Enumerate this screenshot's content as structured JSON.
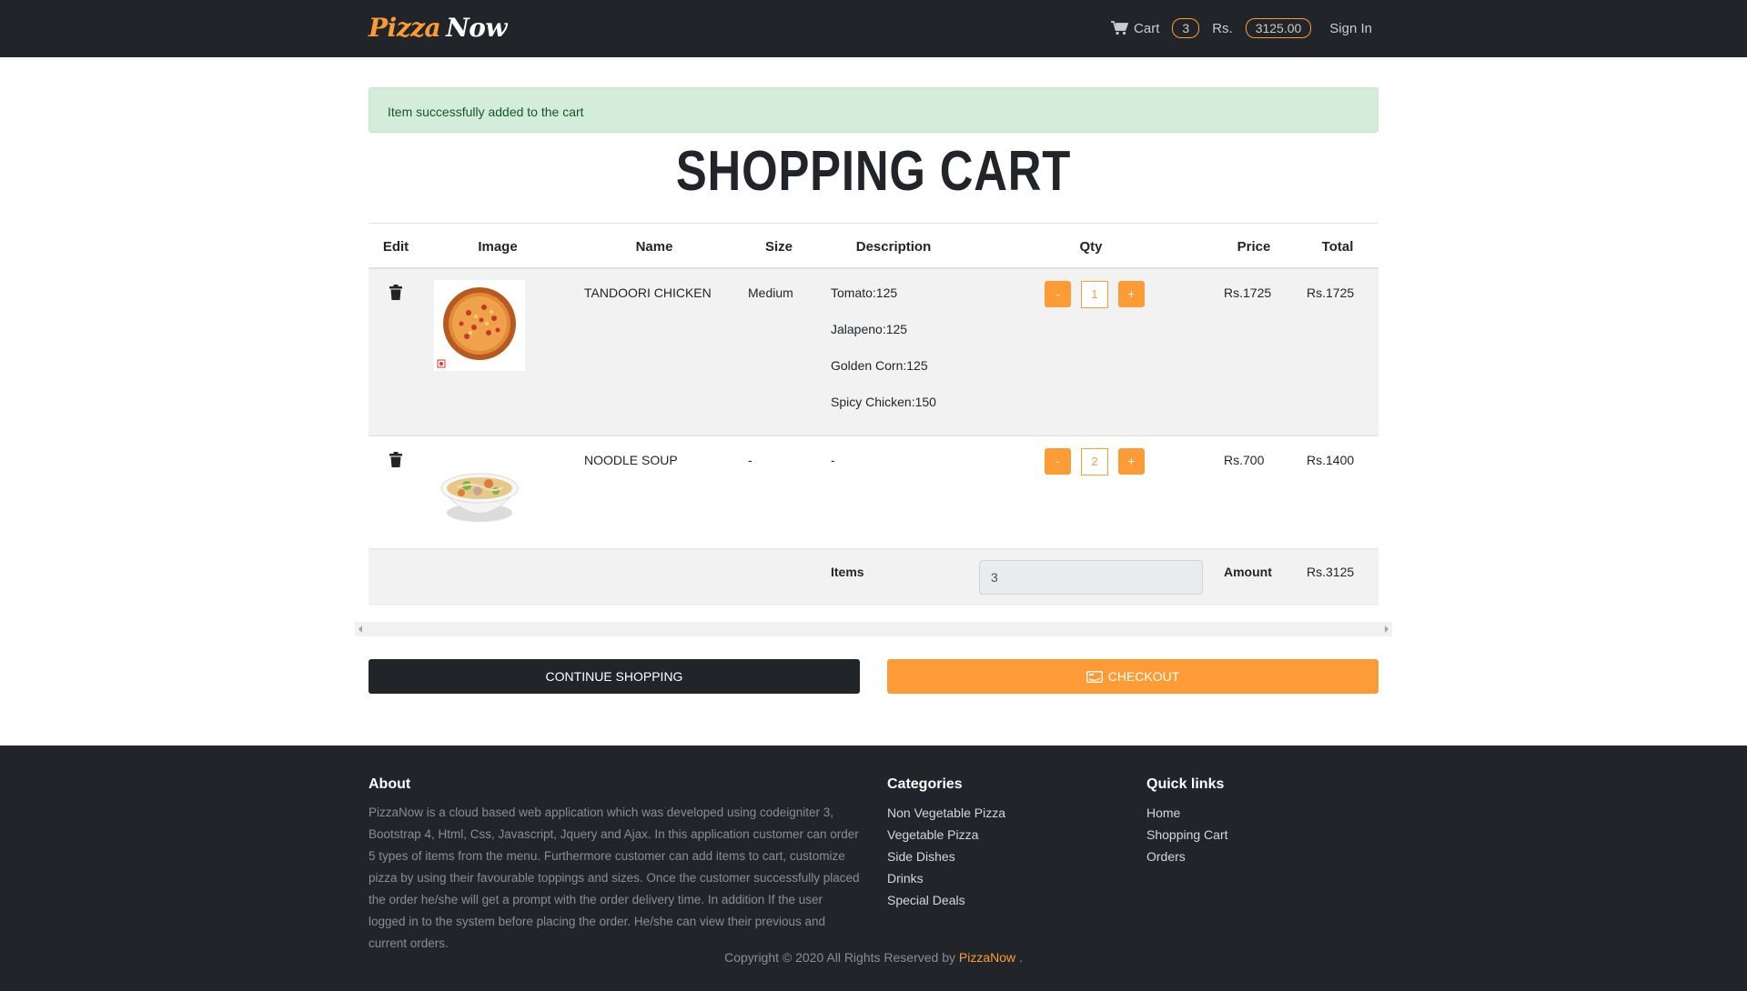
{
  "navbar": {
    "brand_part1": "Pizza",
    "brand_part2": "Now",
    "cart_label": "Cart",
    "cart_count": "3",
    "currency_label": "Rs.",
    "cart_total": "3125.00",
    "signin_label": "Sign In"
  },
  "alert": {
    "message": "Item successfully added to the cart"
  },
  "page_title": "SHOPPING CART",
  "table": {
    "headers": [
      "Edit",
      "Image",
      "Name",
      "Size",
      "Description",
      "Qty",
      "Price",
      "Total"
    ],
    "rows": [
      {
        "name": "TANDOORI CHICKEN",
        "size": "Medium",
        "description": [
          "Tomato:125",
          "Jalapeno:125",
          "Golden Corn:125",
          "Spicy Chicken:150"
        ],
        "qty_minus": "-",
        "qty": "1",
        "qty_plus": "+",
        "price": "Rs.1725",
        "total": "Rs.1725"
      },
      {
        "name": "NOODLE SOUP",
        "size": "-",
        "description": [
          "-"
        ],
        "qty_minus": "-",
        "qty": "2",
        "qty_plus": "+",
        "price": "Rs.700",
        "total": "Rs.1400"
      }
    ],
    "summary": {
      "items_label": "Items",
      "items_value": "3",
      "amount_label": "Amount",
      "amount_value": "Rs.3125"
    }
  },
  "buttons": {
    "continue": "CONTINUE SHOPPING",
    "checkout": "CHECKOUT"
  },
  "footer": {
    "about_title": "About",
    "about_text": "PizzaNow is a cloud based web application which was developed using codeigniter 3, Bootstrap 4, Html, Css, Javascript, Jquery and Ajax. In this application customer can order 5 types of items from the menu. Furthermore customer can add items to cart, customize pizza by using their favourable toppings and sizes. Once the customer successfully placed the order he/she will get a prompt with the order delivery time. In addition If the user logged in to the system before placing the order. He/she can view their previous and current orders.",
    "categories_title": "Categories",
    "categories": [
      "Non Vegetable Pizza",
      "Vegetable Pizza",
      "Side Dishes",
      "Drinks",
      "Special Deals"
    ],
    "quicklinks_title": "Quick links",
    "quicklinks": [
      "Home",
      "Shopping Cart",
      "Orders"
    ],
    "copyright_prefix": "Copyright © 2020 All Rights Reserved by",
    "copyright_brand": "PizzaNow",
    "copyright_suffix": "."
  },
  "colors": {
    "accent": "#fd9c37",
    "dark": "#212529",
    "alert_bg": "#d4edda",
    "row_shade": "#f2f2f2"
  },
  "icons": {
    "cart": "shopping-cart-icon",
    "trash": "trash-icon",
    "checkout": "payment-icon"
  }
}
